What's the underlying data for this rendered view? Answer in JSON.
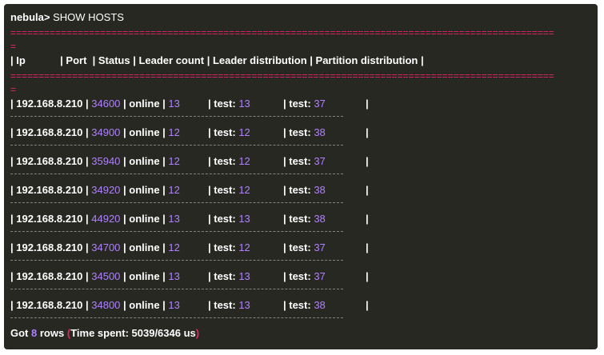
{
  "prompt": "nebula>",
  "command": "SHOW HOSTS",
  "separator": "=================================================================================================",
  "separator_tail": "=",
  "header": "| Ip            | Port  | Status | Leader count | Leader distribution | Partition distribution |",
  "pipe": "|",
  "status_word": "online",
  "test_label": "test:",
  "rows": [
    {
      "ip": "192.168.8.210",
      "port": "34600",
      "status": "online",
      "leader_count": "13",
      "leader_dist": "13",
      "partition_dist": "37"
    },
    {
      "ip": "192.168.8.210",
      "port": "34900",
      "status": "online",
      "leader_count": "12",
      "leader_dist": "12",
      "partition_dist": "38"
    },
    {
      "ip": "192.168.8.210",
      "port": "35940",
      "status": "online",
      "leader_count": "12",
      "leader_dist": "12",
      "partition_dist": "37"
    },
    {
      "ip": "192.168.8.210",
      "port": "34920",
      "status": "online",
      "leader_count": "12",
      "leader_dist": "12",
      "partition_dist": "38"
    },
    {
      "ip": "192.168.8.210",
      "port": "44920",
      "status": "online",
      "leader_count": "13",
      "leader_dist": "13",
      "partition_dist": "38"
    },
    {
      "ip": "192.168.8.210",
      "port": "34700",
      "status": "online",
      "leader_count": "12",
      "leader_dist": "12",
      "partition_dist": "37"
    },
    {
      "ip": "192.168.8.210",
      "port": "34500",
      "status": "online",
      "leader_count": "13",
      "leader_dist": "13",
      "partition_dist": "37"
    },
    {
      "ip": "192.168.8.210",
      "port": "34800",
      "status": "online",
      "leader_count": "13",
      "leader_dist": "13",
      "partition_dist": "38"
    }
  ],
  "footer": {
    "got": "Got",
    "count": "8",
    "rows_word": "rows",
    "open_paren": "(",
    "time_text": "Time spent: 5039/6346 us",
    "close_paren": ")"
  },
  "colors": {
    "background": "#272822",
    "text": "#ffffff",
    "number": "#ae81ff",
    "separator": "#e6256b"
  }
}
